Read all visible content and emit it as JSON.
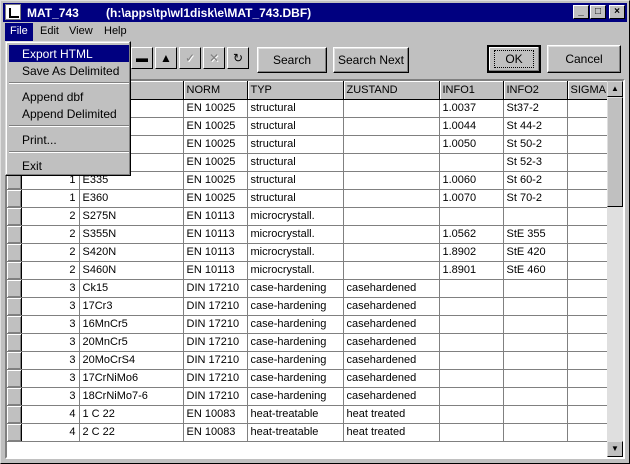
{
  "window": {
    "title": "MAT_743",
    "path": "(h:\\apps\\tp\\wl1disk\\e\\MAT_743.DBF)",
    "controls": {
      "minimize": "_",
      "maximize": "□",
      "close": "×"
    }
  },
  "menubar": {
    "items": [
      {
        "label": "File",
        "active": true
      },
      {
        "label": "Edit"
      },
      {
        "label": "View"
      },
      {
        "label": "Help"
      }
    ]
  },
  "file_menu": {
    "items": [
      "Export HTML",
      "Save As Delimited",
      "Append dbf",
      "Append Delimited",
      "Print...",
      "Exit"
    ],
    "highlighted": "Export HTML"
  },
  "toolbar": {
    "icons": [
      "minus-icon",
      "up-triangle-icon",
      "checkmark-icon",
      "x-icon",
      "refresh-icon"
    ],
    "icon_glyphs": [
      "▬",
      "▲",
      "✓",
      "✕",
      "↻"
    ],
    "search_label": "Search",
    "search_next_label": "Search Next",
    "ok_label": "OK",
    "cancel_label": "Cancel"
  },
  "table": {
    "columns": [
      "",
      "",
      "",
      "NORM",
      "TYP",
      "ZUSTAND",
      "INFO1",
      "INFO2",
      "SIGMA"
    ],
    "rows": [
      [
        "",
        "",
        "",
        "EN 10025",
        "structural",
        "",
        "1.0037",
        "St37-2",
        ""
      ],
      [
        "",
        "",
        "",
        "EN 10025",
        "structural",
        "",
        "1.0044",
        "St 44-2",
        ""
      ],
      [
        "",
        "",
        "",
        "EN 10025",
        "structural",
        "",
        "1.0050",
        "St 50-2",
        ""
      ],
      [
        "",
        "",
        "",
        "EN 10025",
        "structural",
        "",
        "",
        "St 52-3",
        ""
      ],
      [
        "",
        "1",
        "E335",
        "EN 10025",
        "structural",
        "",
        "1.0060",
        "St 60-2",
        ""
      ],
      [
        "",
        "1",
        "E360",
        "EN 10025",
        "structural",
        "",
        "1.0070",
        "St 70-2",
        ""
      ],
      [
        "",
        "2",
        "S275N",
        "EN 10113",
        "microcrystall.",
        "",
        "",
        "",
        ""
      ],
      [
        "",
        "2",
        "S355N",
        "EN 10113",
        "microcrystall.",
        "",
        "1.0562",
        "StE 355",
        ""
      ],
      [
        "",
        "2",
        "S420N",
        "EN 10113",
        "microcrystall.",
        "",
        "1.8902",
        "StE 420",
        ""
      ],
      [
        "",
        "2",
        "S460N",
        "EN 10113",
        "microcrystall.",
        "",
        "1.8901",
        "StE 460",
        ""
      ],
      [
        "",
        "3",
        "Ck15",
        "DIN 17210",
        "case-hardening",
        "casehardened",
        "",
        "",
        ""
      ],
      [
        "",
        "3",
        "17Cr3",
        "DIN 17210",
        "case-hardening",
        "casehardened",
        "",
        "",
        ""
      ],
      [
        "",
        "3",
        "16MnCr5",
        "DIN 17210",
        "case-hardening",
        "casehardened",
        "",
        "",
        ""
      ],
      [
        "",
        "3",
        "20MnCr5",
        "DIN 17210",
        "case-hardening",
        "casehardened",
        "",
        "",
        ""
      ],
      [
        "",
        "3",
        "20MoCrS4",
        "DIN 17210",
        "case-hardening",
        "casehardened",
        "",
        "",
        ""
      ],
      [
        "",
        "3",
        "17CrNiMo6",
        "DIN 17210",
        "case-hardening",
        "casehardened",
        "",
        "",
        ""
      ],
      [
        "",
        "3",
        "18CrNiMo7-6",
        "DIN 17210",
        "case-hardening",
        "casehardened",
        "",
        "",
        ""
      ],
      [
        "",
        "4",
        "1 C 22",
        "EN 10083",
        "heat-treatable",
        "heat treated",
        "",
        "",
        ""
      ],
      [
        "",
        "4",
        "2 C 22",
        "EN 10083",
        "heat-treatable",
        "heat treated",
        "",
        "",
        ""
      ]
    ]
  }
}
